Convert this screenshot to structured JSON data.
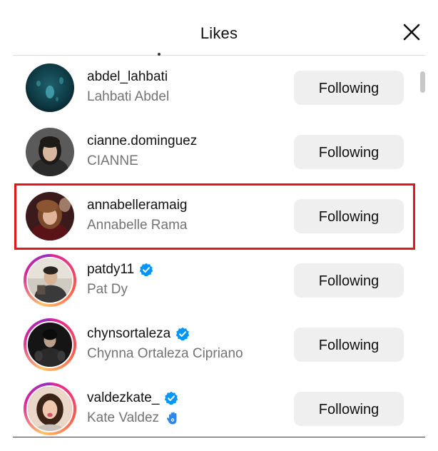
{
  "modal": {
    "title": "Likes",
    "close_icon": "close-icon"
  },
  "colors": {
    "button_bg": "#efefef",
    "verified": "#0095f6",
    "highlight": "#e3161d",
    "secondary_text": "#737373"
  },
  "likes": [
    {
      "username": "abdel_lahbati",
      "full_name": "Lahbati Abdel",
      "button_label": "Following",
      "verified": false,
      "story_ring": false
    },
    {
      "username": "cianne.dominguez",
      "full_name": "CIANNE",
      "button_label": "Following",
      "verified": false,
      "story_ring": false
    },
    {
      "username": "annabelleramaig",
      "full_name": "Annabelle Rama",
      "button_label": "Following",
      "verified": false,
      "story_ring": false,
      "highlighted": true
    },
    {
      "username": "patdy11",
      "full_name": "Pat Dy",
      "button_label": "Following",
      "verified": true,
      "story_ring": true
    },
    {
      "username": "chynsortaleza",
      "full_name": "Chynna Ortaleza Cipriano",
      "button_label": "Following",
      "verified": true,
      "story_ring": true
    },
    {
      "username": "valdezkate_",
      "full_name": "Kate Valdez",
      "button_label": "Following",
      "verified": true,
      "story_ring": true,
      "name_emoji": "waving-hand-icon"
    }
  ]
}
